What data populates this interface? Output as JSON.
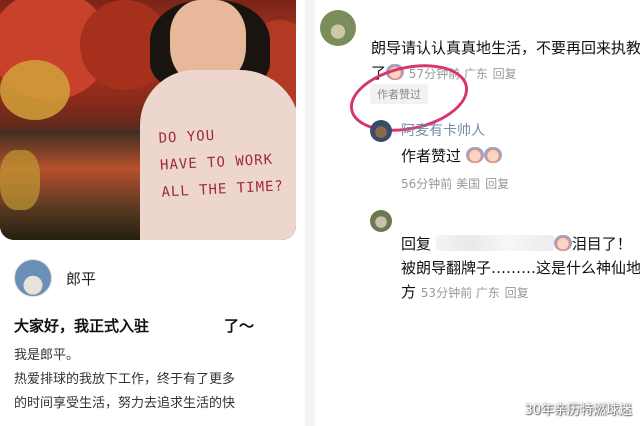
{
  "post": {
    "author_name": "郎平",
    "title": "大家好，我正式入驻　　　　　了～",
    "body_lines": [
      "我是郎平。",
      "热爱排球的我放下工作，终于有了更多",
      "的时间享受生活，努力去追求生活的快"
    ],
    "photo": {
      "shirt_text": "DO YOU\nHAVE TO WORK\nALL THE TIME?"
    }
  },
  "comments": {
    "c1": {
      "text": "朗导请认认真真地生活，不要再回来执教了",
      "meta": "57分钟前 广东",
      "reply_label": "回复",
      "liked_badge": "作者赞过"
    },
    "r1": {
      "name": "阿麦有卡帅人",
      "text": "作者赞过",
      "meta": "56分钟前 美国",
      "reply_label": "回复"
    },
    "r2": {
      "name": "",
      "text_before": "回复",
      "text_after": "泪目了！被朗导翻牌子………这是什么神仙地方",
      "meta": "53分钟前 广东",
      "reply_label": "回复"
    }
  },
  "watermark": "30年亲历特燃球迷",
  "colors": {
    "annotation": "#d8356e",
    "shirt_print": "#a02a3a",
    "reply_name": "#7a8aa8",
    "meta": "#999999"
  },
  "icons": [
    "emoji-face-icon"
  ]
}
